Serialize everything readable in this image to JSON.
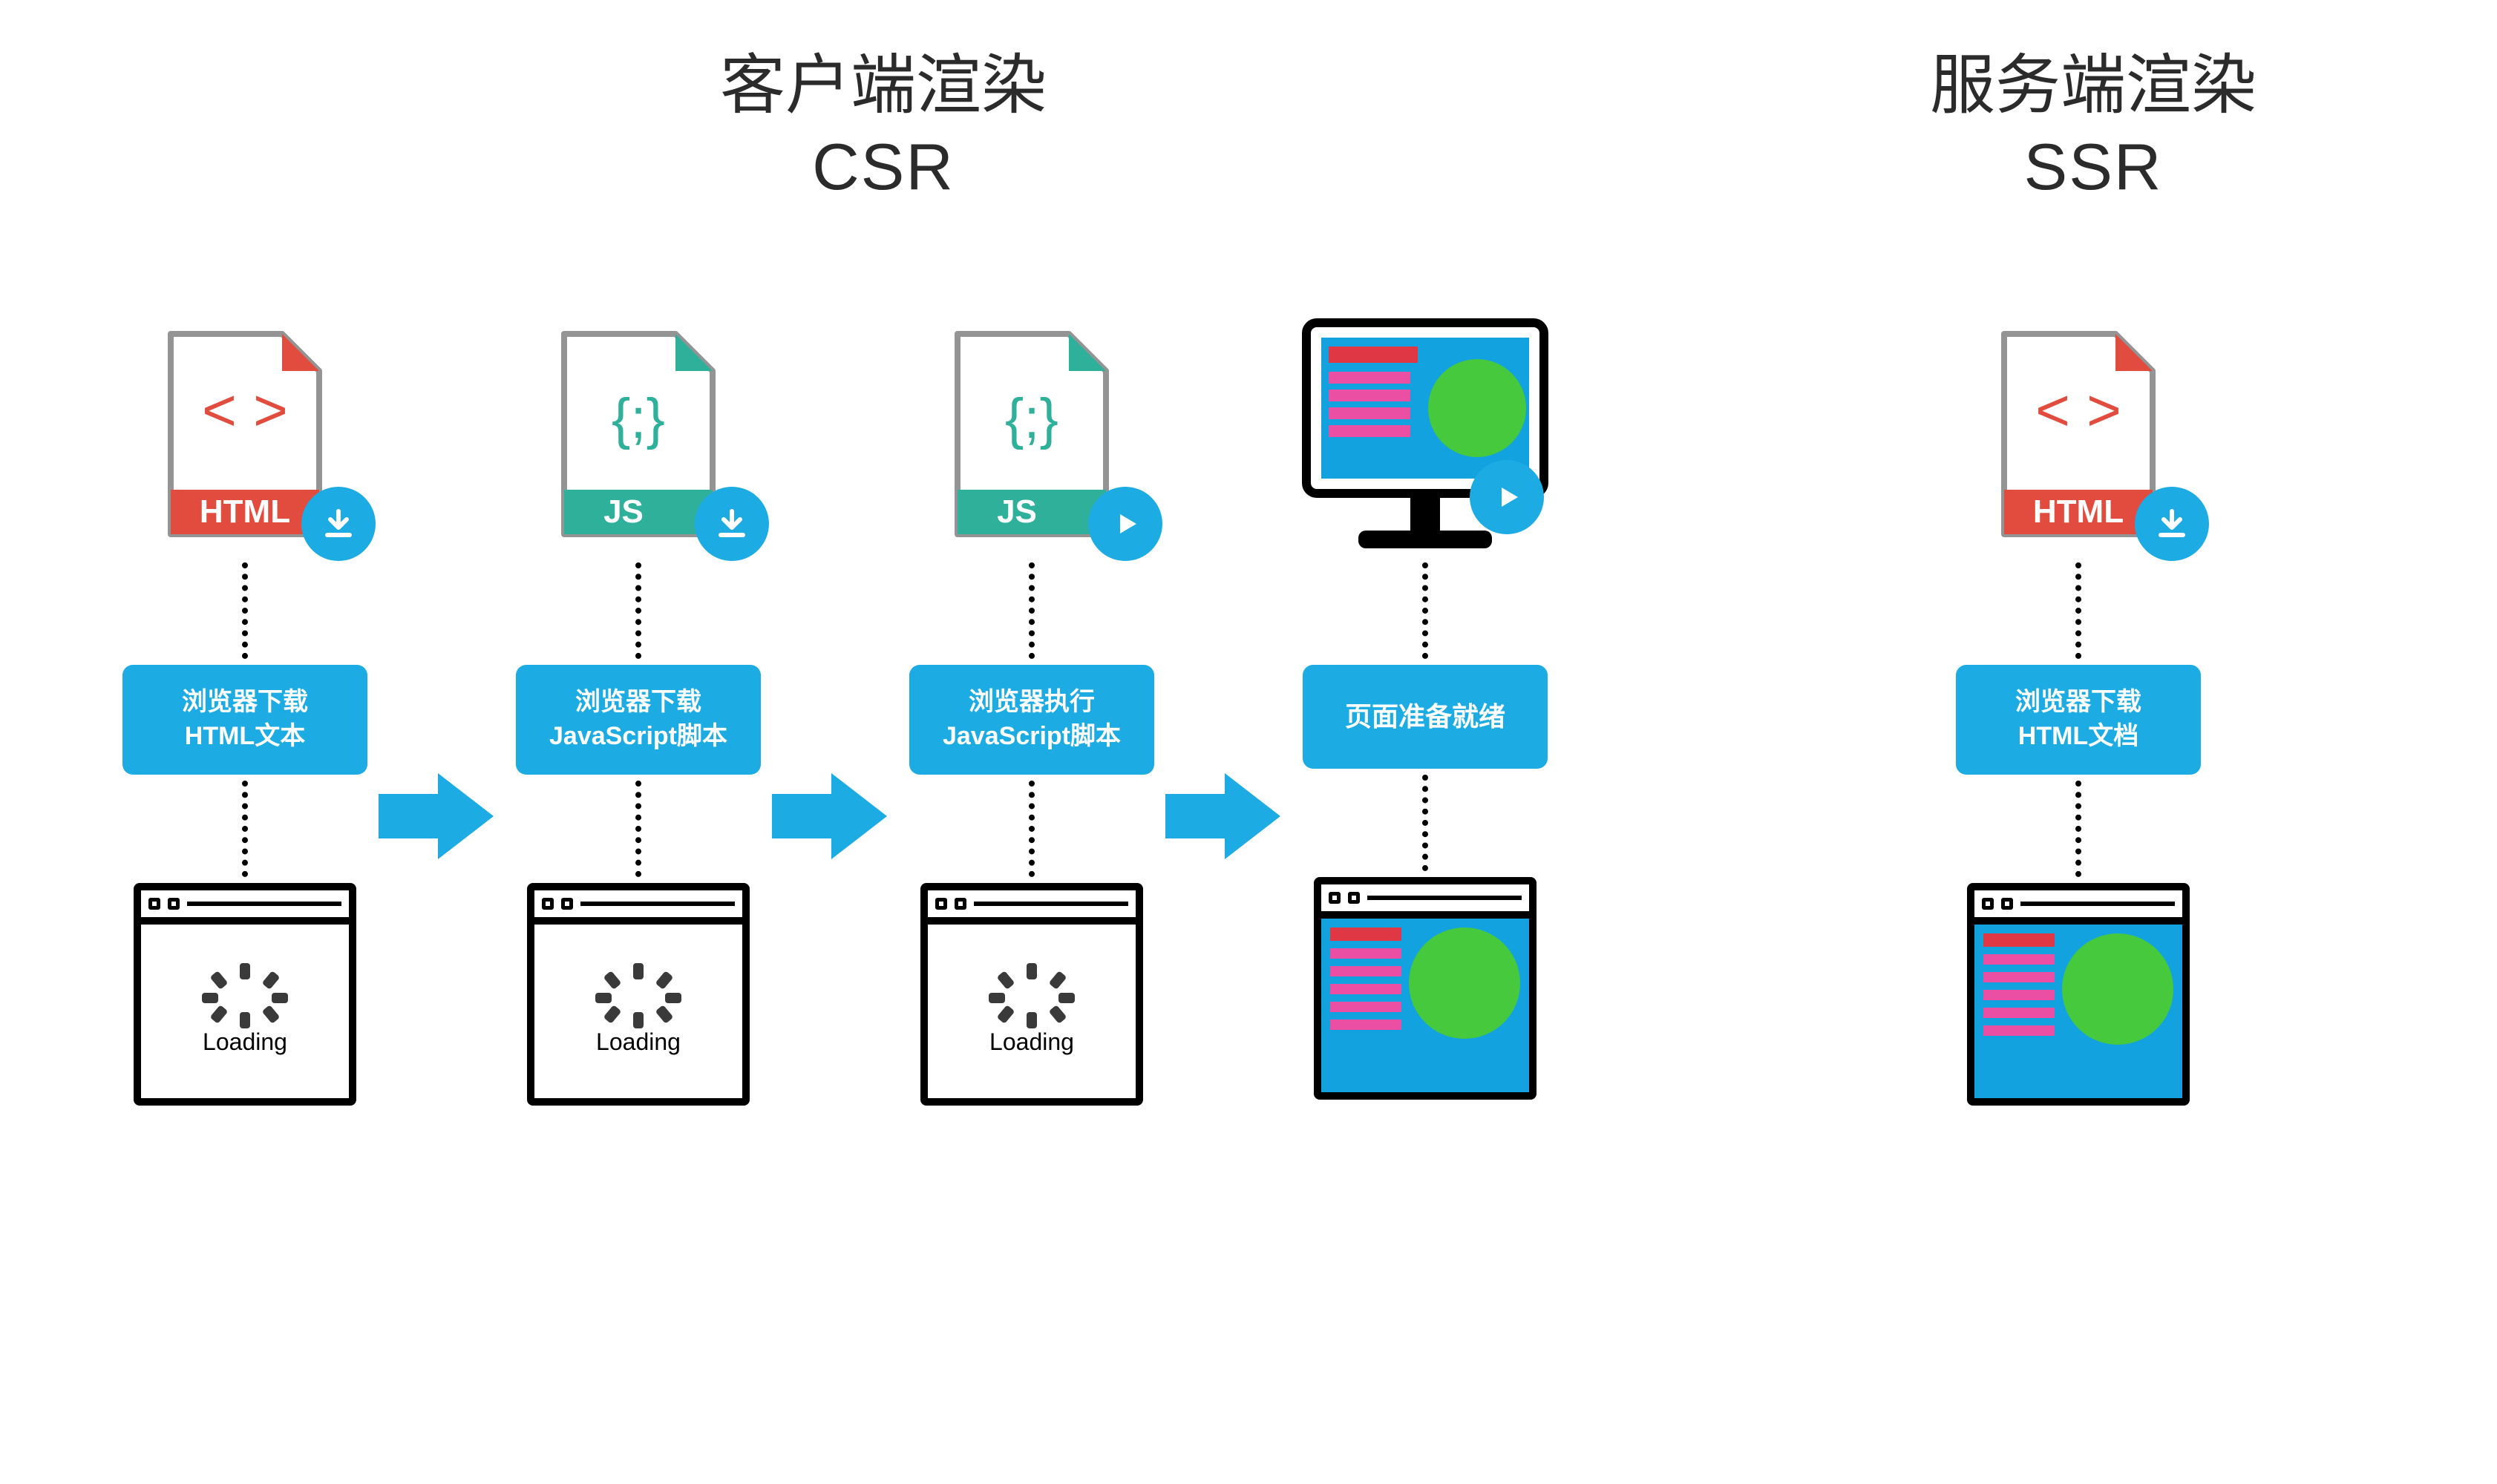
{
  "headers": {
    "csr": {
      "line1": "客户端渲染",
      "line2": "CSR"
    },
    "ssr": {
      "line1": "服务端渲染",
      "line2": "SSR"
    }
  },
  "csr_steps": [
    {
      "line1": "浏览器下载",
      "line2": "HTML文本",
      "file_badge": "HTML",
      "badge_action": "download",
      "result": "loading"
    },
    {
      "line1": "浏览器下载",
      "line2": "JavaScript脚本",
      "file_badge": "JS",
      "badge_action": "download",
      "result": "loading"
    },
    {
      "line1": "浏览器执行",
      "line2": "JavaScript脚本",
      "file_badge": "JS",
      "badge_action": "play",
      "result": "loading"
    },
    {
      "line1": "页面准备就绪",
      "line2": "",
      "file_badge": "MONITOR",
      "badge_action": "play",
      "result": "rendered"
    }
  ],
  "ssr_steps": [
    {
      "line1": "浏览器下载",
      "line2": "HTML文档",
      "file_badge": "HTML",
      "badge_action": "download",
      "result": "rendered"
    }
  ],
  "loading_label": "Loading",
  "colors": {
    "primary_blue": "#1cace3",
    "html_red": "#e24c3f",
    "js_teal": "#2fb09a",
    "green": "#47c93d",
    "pink": "#ea4fa3"
  },
  "icons": {
    "download": "download-icon",
    "play": "play-icon",
    "html_file": "html-file-icon",
    "js_file": "js-file-icon",
    "monitor": "monitor-rendered-icon",
    "spinner": "spinner-icon",
    "browser_loading": "browser-loading-icon",
    "browser_rendered": "browser-rendered-icon",
    "arrow": "arrow-right-icon"
  }
}
